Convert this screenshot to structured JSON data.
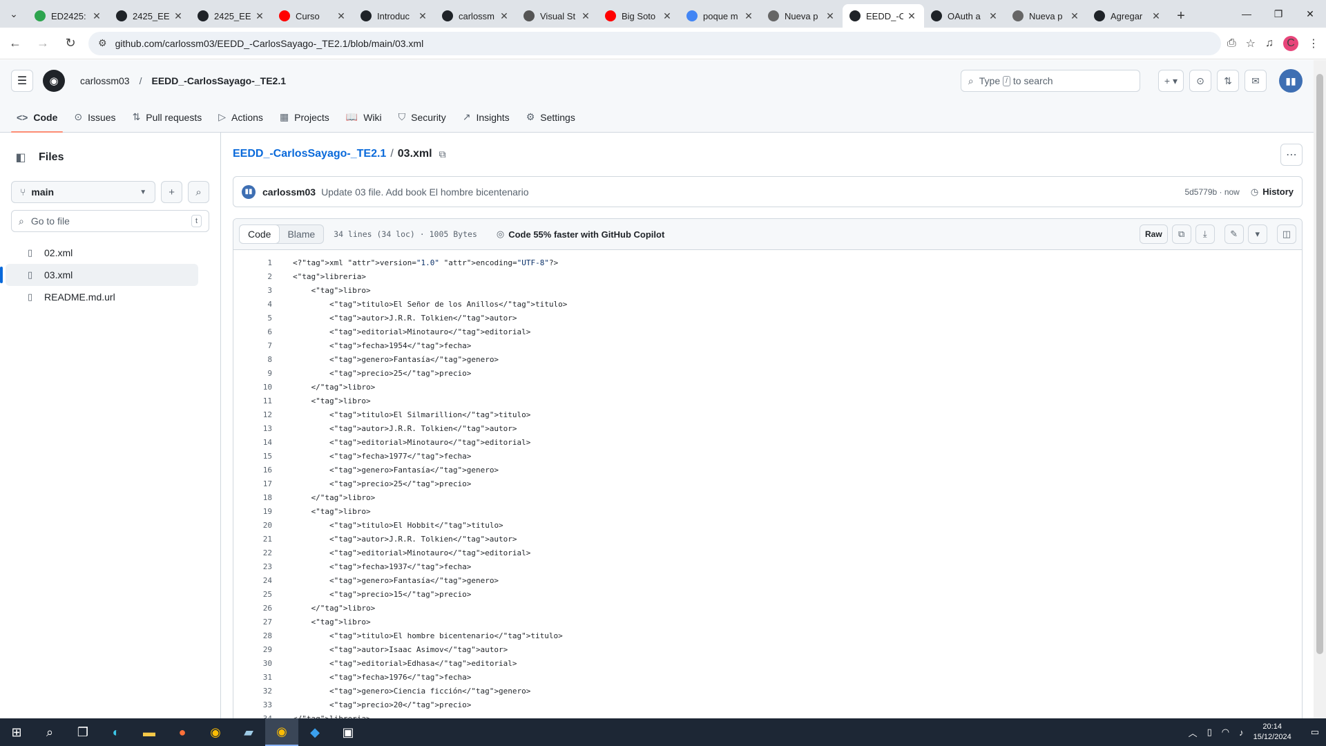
{
  "browser": {
    "tabs": [
      {
        "title": "ED2425:",
        "color": "#2da44e",
        "icon": "gitlab-icon"
      },
      {
        "title": "2425_EE",
        "color": "#1f2328",
        "icon": "github-icon"
      },
      {
        "title": "2425_EE",
        "color": "#1f2328",
        "icon": "github-icon"
      },
      {
        "title": "Curso",
        "color": "#ff0000",
        "icon": "youtube-icon"
      },
      {
        "title": "Introduc",
        "color": "#1f2328",
        "icon": "github-icon"
      },
      {
        "title": "carlossm",
        "color": "#1f2328",
        "icon": "github-icon"
      },
      {
        "title": "Visual St",
        "color": "#555555",
        "icon": "cloud-icon"
      },
      {
        "title": "Big Soto",
        "color": "#ff0000",
        "icon": "youtube-icon"
      },
      {
        "title": "poque m",
        "color": "#4285f4",
        "icon": "google-icon"
      },
      {
        "title": "Nueva p",
        "color": "#666666",
        "icon": "chrome-icon"
      },
      {
        "title": "EEDD_-C",
        "color": "#1f2328",
        "icon": "github-icon",
        "active": true
      },
      {
        "title": "OAuth a",
        "color": "#1f2328",
        "icon": "github-icon"
      },
      {
        "title": "Nueva p",
        "color": "#666666",
        "icon": "chrome-icon"
      },
      {
        "title": "Agregar",
        "color": "#1f2328",
        "icon": "github-icon"
      }
    ],
    "url": "github.com/carlossm03/EEDD_-CarlosSayago-_TE2.1/blob/main/03.xml",
    "profile_initial": "C"
  },
  "header": {
    "owner": "carlossm03",
    "separator": "/",
    "repo": "EEDD_-CarlosSayago-_TE2.1",
    "search_placeholder_pre": "Type",
    "search_key": "/",
    "search_placeholder_post": "to search"
  },
  "reponav": [
    {
      "label": "Code",
      "icon": "<>"
    },
    {
      "label": "Issues",
      "icon": "⊙"
    },
    {
      "label": "Pull requests",
      "icon": "⇅"
    },
    {
      "label": "Actions",
      "icon": "▷"
    },
    {
      "label": "Projects",
      "icon": "▦"
    },
    {
      "label": "Wiki",
      "icon": "📖"
    },
    {
      "label": "Security",
      "icon": "⛉"
    },
    {
      "label": "Insights",
      "icon": "↗"
    },
    {
      "label": "Settings",
      "icon": "⚙"
    }
  ],
  "sidebar": {
    "title": "Files",
    "branch": "main",
    "goto_placeholder": "Go to file",
    "goto_key": "t",
    "files": [
      "02.xml",
      "03.xml",
      "README.md.url"
    ],
    "active_file": "03.xml"
  },
  "breadcrumb": {
    "repo": "EEDD_-CarlosSayago-_TE2.1",
    "sep": "/",
    "file": "03.xml"
  },
  "commit": {
    "author": "carlossm03",
    "message": "Update 03 file. Add book El hombre bicentenario",
    "sha_time": "5d5779b · now",
    "history_label": "History"
  },
  "viewer": {
    "tab_code": "Code",
    "tab_blame": "Blame",
    "meta": "34 lines (34 loc) · 1005 Bytes",
    "copilot": "Code 55% faster with GitHub Copilot",
    "raw": "Raw"
  },
  "code_lines": [
    "<?xml version=\"1.0\" encoding=\"UTF-8\"?>",
    "<libreria>",
    "    <libro>",
    "        <titulo>El Señor de los Anillos</titulo>",
    "        <autor>J.R.R. Tolkien</autor>",
    "        <editorial>Minotauro</editorial>",
    "        <fecha>1954</fecha>",
    "        <genero>Fantasía</genero>",
    "        <precio>25</precio>",
    "    </libro>",
    "    <libro>",
    "        <titulo>El Silmarillion</titulo>",
    "        <autor>J.R.R. Tolkien</autor>",
    "        <editorial>Minotauro</editorial>",
    "        <fecha>1977</fecha>",
    "        <genero>Fantasía</genero>",
    "        <precio>25</precio>",
    "    </libro>",
    "    <libro>",
    "        <titulo>El Hobbit</titulo>",
    "        <autor>J.R.R. Tolkien</autor>",
    "        <editorial>Minotauro</editorial>",
    "        <fecha>1937</fecha>",
    "        <genero>Fantasía</genero>",
    "        <precio>15</precio>",
    "    </libro>",
    "    <libro>",
    "        <titulo>El hombre bicentenario</titulo>",
    "        <autor>Isaac Asimov</autor>",
    "        <editorial>Edhasa</editorial>",
    "        <fecha>1976</fecha>",
    "        <genero>Ciencia ficción</genero>",
    "        <precio>20</precio>",
    "</libreria>"
  ],
  "taskbar": {
    "time": "20:14",
    "date": "15/12/2024"
  }
}
